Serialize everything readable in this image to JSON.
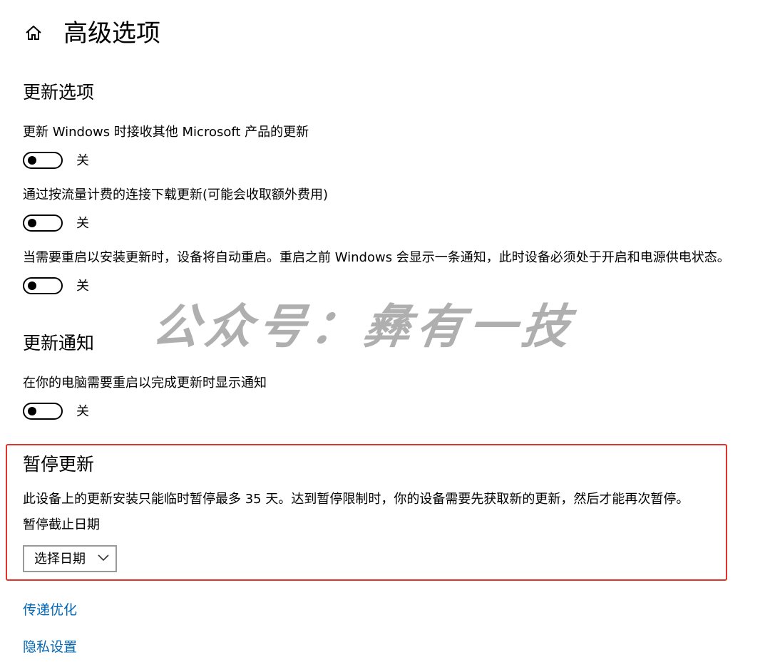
{
  "header": {
    "title": "高级选项",
    "home_icon": "home-icon"
  },
  "update_options": {
    "title": "更新选项",
    "items": [
      {
        "label": "更新 Windows 时接收其他 Microsoft 产品的更新",
        "state": "关"
      },
      {
        "label": "通过按流量计费的连接下载更新(可能会收取额外费用)",
        "state": "关"
      },
      {
        "label": "当需要重启以安装更新时，设备将自动重启。重启之前 Windows 会显示一条通知，此时设备必须处于开启和电源供电状态。",
        "state": "关"
      }
    ]
  },
  "update_notifications": {
    "title": "更新通知",
    "items": [
      {
        "label": "在你的电脑需要重启以完成更新时显示通知",
        "state": "关"
      }
    ]
  },
  "pause_updates": {
    "title": "暂停更新",
    "description": "此设备上的更新安装只能临时暂停最多 35 天。达到暂停限制时，你的设备需要先获取新的更新，然后才能再次暂停。",
    "date_label": "暂停截止日期",
    "select_value": "选择日期"
  },
  "links": {
    "delivery_optimization": "传递优化",
    "privacy_settings": "隐私设置"
  },
  "watermark": "公众号：彝有一技",
  "colors": {
    "link": "#0067b8",
    "highlight_border": "#e0332b",
    "toggle_off": "#000000"
  }
}
